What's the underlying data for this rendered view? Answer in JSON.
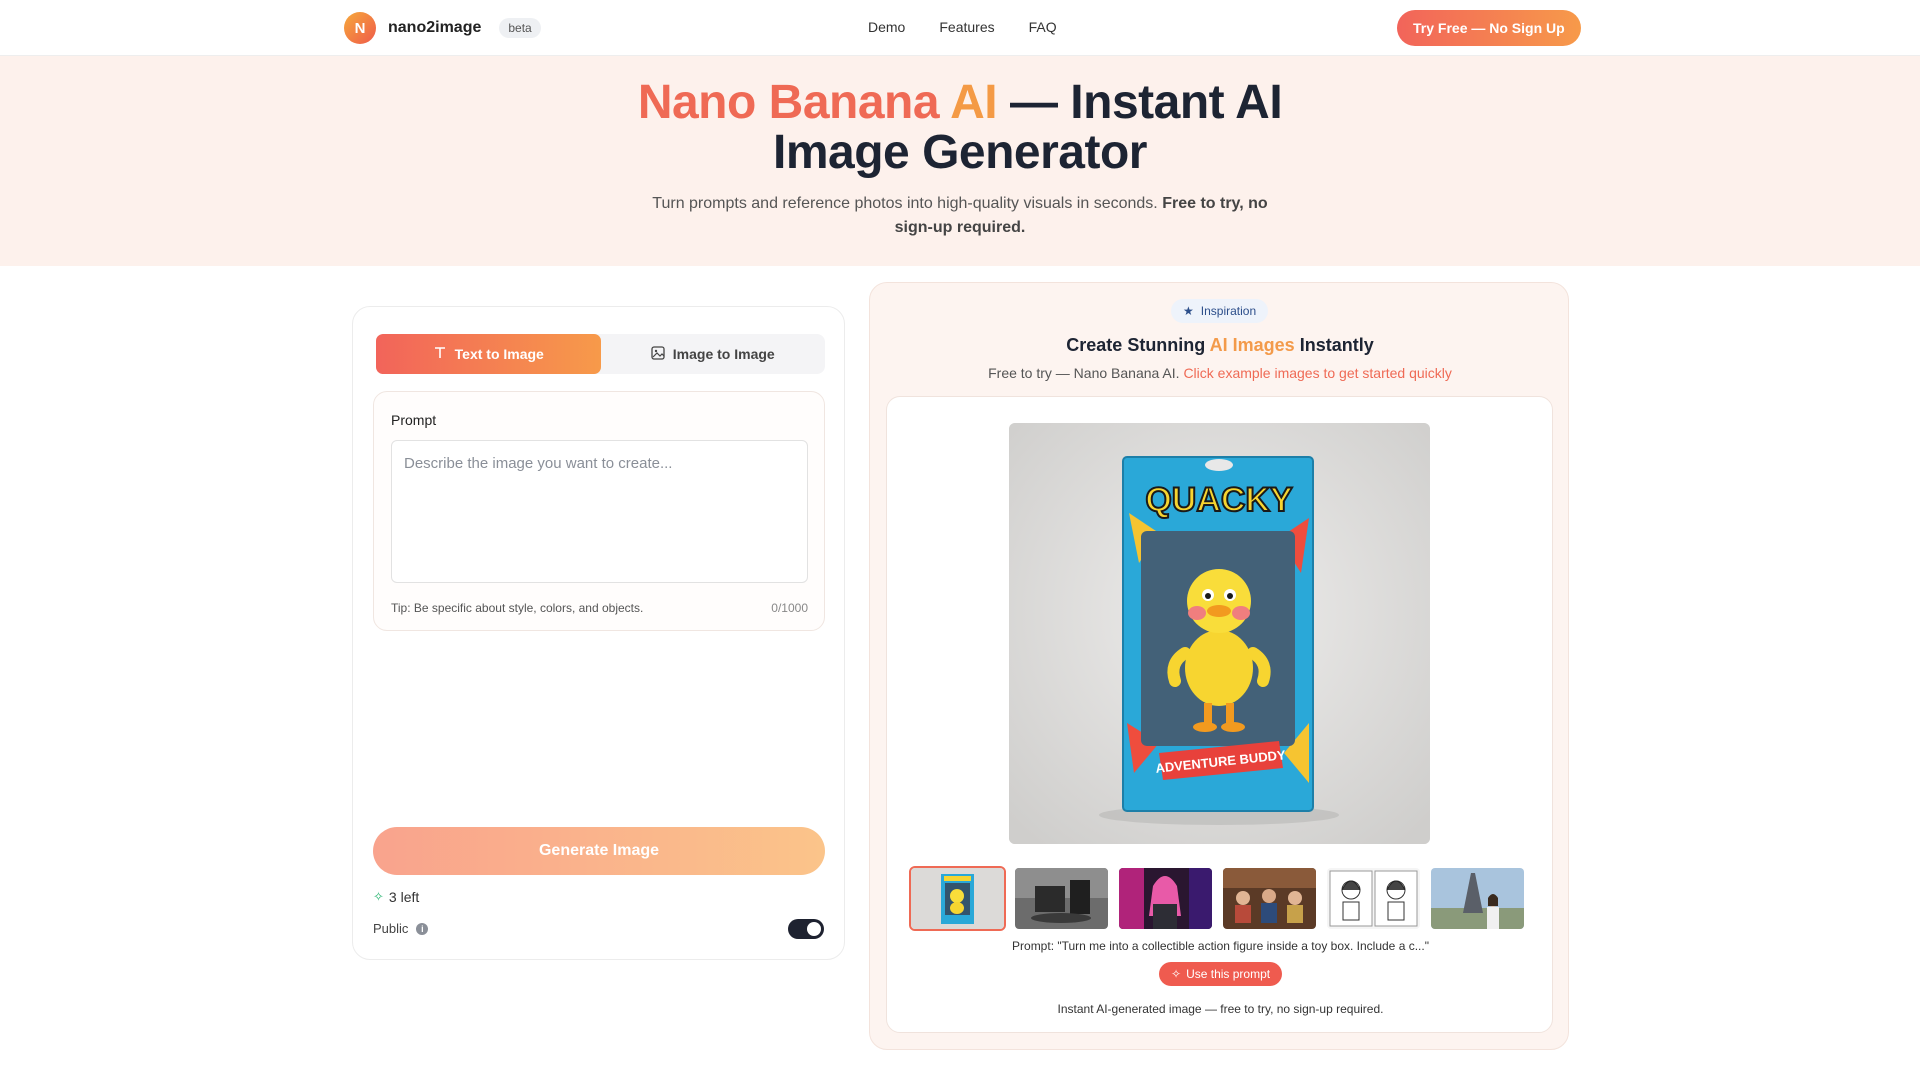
{
  "nav": {
    "logo_letter": "N",
    "brand": "nano2image",
    "badge": "beta",
    "links": [
      "Demo",
      "Features",
      "FAQ"
    ],
    "cta": "Try Free — No Sign Up"
  },
  "hero": {
    "title_part1": "Nano Banana",
    "title_part2": "AI",
    "title_part3": "— Instant AI Image Generator",
    "subtitle": "Turn prompts and reference photos into high-quality visuals in seconds.",
    "subtitle_bold": "Free to try, no sign-up required."
  },
  "generator": {
    "tabs": [
      {
        "label": "Text to Image",
        "icon": "text-icon",
        "active": true
      },
      {
        "label": "Image to Image",
        "icon": "image-icon",
        "active": false
      }
    ],
    "prompt_label": "Prompt",
    "prompt_value": "",
    "prompt_placeholder": "Describe the image you want to create...",
    "tip": "Tip: Be specific about style, colors, and objects.",
    "char_count": "0/1000",
    "generate_label": "Generate Image",
    "credits_left": "3 left",
    "public_label": "Public",
    "public_enabled": true
  },
  "inspiration": {
    "badge": "Inspiration",
    "title_pre": "Create Stunning",
    "title_hl": "AI Images",
    "title_post": "Instantly",
    "sub_pre": "Free to try — Nano Banana AI.",
    "sub_link": "Click example images to get started quickly",
    "thumbnails": [
      "action-figure",
      "photo-studio",
      "neon-portrait",
      "family-room",
      "sketch-portraits",
      "eiffel-tower"
    ],
    "selected_index": 0,
    "prompt_text": "Prompt: \"Turn me into a collectible action figure inside a toy box. Include a c...\"",
    "use_prompt_label": "Use this prompt",
    "footer": "Instant AI-generated image — free to try, no sign-up required.",
    "image_text": {
      "brand": "QUACKY",
      "tag": "ADVENTURE BUDDY"
    }
  },
  "colors": {
    "accent_start": "#f2645a",
    "accent_end": "#f79a4a",
    "hero_bg": "#fdf1ec"
  }
}
